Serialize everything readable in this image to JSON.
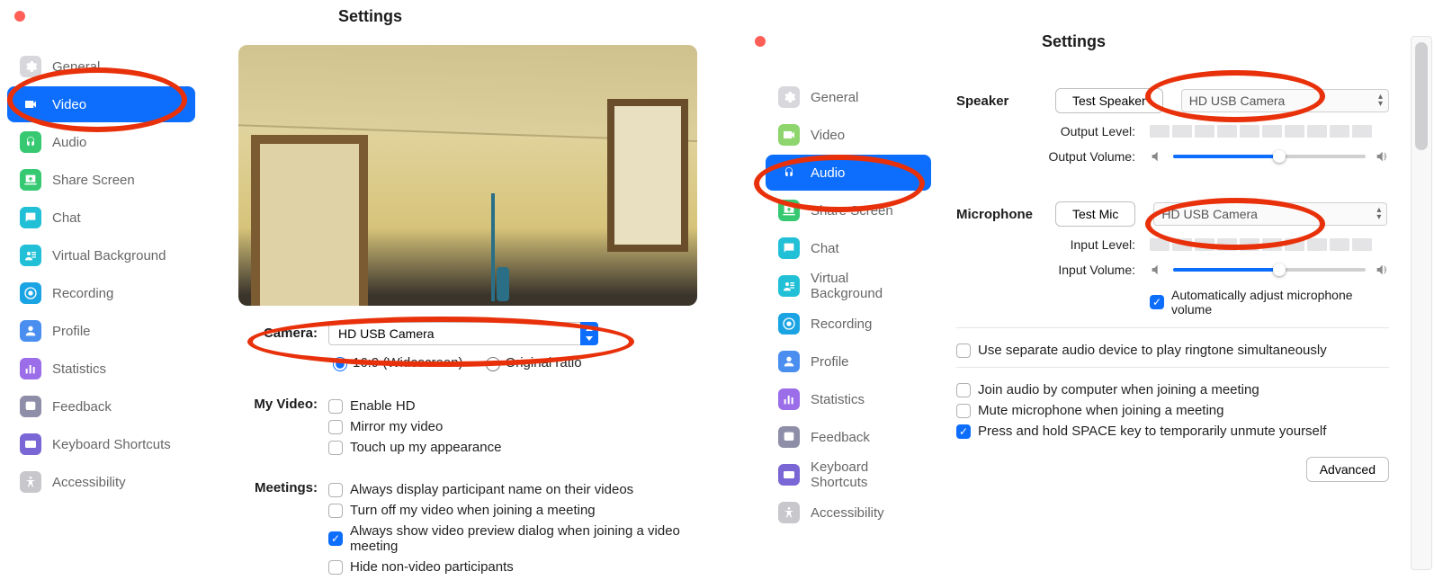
{
  "left": {
    "title": "Settings",
    "sidebar": [
      {
        "key": "general",
        "label": "General",
        "color": "#d7d7dc"
      },
      {
        "key": "video",
        "label": "Video",
        "color": "#0d6efd"
      },
      {
        "key": "audio",
        "label": "Audio",
        "color": "#36c971"
      },
      {
        "key": "share",
        "label": "Share Screen",
        "color": "#36c971"
      },
      {
        "key": "chat",
        "label": "Chat",
        "color": "#22c0d6"
      },
      {
        "key": "vbg",
        "label": "Virtual Background",
        "color": "#22c0d6"
      },
      {
        "key": "rec",
        "label": "Recording",
        "color": "#1aa4e4"
      },
      {
        "key": "profile",
        "label": "Profile",
        "color": "#4a8ff0"
      },
      {
        "key": "stats",
        "label": "Statistics",
        "color": "#9b6de8"
      },
      {
        "key": "feedback",
        "label": "Feedback",
        "color": "#8e8ea8"
      },
      {
        "key": "kbd",
        "label": "Keyboard Shortcuts",
        "color": "#7a66d5"
      },
      {
        "key": "a11y",
        "label": "Accessibility",
        "color": "#c7c7cc"
      }
    ],
    "selected": "video",
    "camera_label": "Camera:",
    "camera_value": "HD USB Camera",
    "myvideo_label": "My Video:",
    "meetings_label": "Meetings:",
    "ratio": {
      "wide": "16:9 (Widescreen)",
      "orig": "Original ratio",
      "value": "wide"
    },
    "myvideo": [
      {
        "k": "hd",
        "label": "Enable HD",
        "checked": false
      },
      {
        "k": "mirror",
        "label": "Mirror my video",
        "checked": false
      },
      {
        "k": "touchup",
        "label": "Touch up my appearance",
        "checked": false
      }
    ],
    "meetings": [
      {
        "k": "names",
        "label": "Always display participant name on their videos",
        "checked": false
      },
      {
        "k": "turnoff",
        "label": "Turn off my video when joining a meeting",
        "checked": false
      },
      {
        "k": "preview",
        "label": "Always show video preview dialog when joining a video meeting",
        "checked": true
      },
      {
        "k": "hidenv",
        "label": "Hide non-video participants",
        "checked": false
      }
    ]
  },
  "right": {
    "title": "Settings",
    "sidebar": [
      {
        "key": "general",
        "label": "General",
        "color": "#d7d7dc"
      },
      {
        "key": "video",
        "label": "Video",
        "color": "#8ed56e"
      },
      {
        "key": "audio",
        "label": "Audio",
        "color": "#0d6efd"
      },
      {
        "key": "share",
        "label": "Share Screen",
        "color": "#36c971"
      },
      {
        "key": "chat",
        "label": "Chat",
        "color": "#22c0d6"
      },
      {
        "key": "vbg",
        "label": "Virtual Background",
        "color": "#22c0d6"
      },
      {
        "key": "rec",
        "label": "Recording",
        "color": "#1aa4e4"
      },
      {
        "key": "profile",
        "label": "Profile",
        "color": "#4a8ff0"
      },
      {
        "key": "stats",
        "label": "Statistics",
        "color": "#9b6de8"
      },
      {
        "key": "feedback",
        "label": "Feedback",
        "color": "#8e8ea8"
      },
      {
        "key": "kbd",
        "label": "Keyboard Shortcuts",
        "color": "#7a66d5"
      },
      {
        "key": "a11y",
        "label": "Accessibility",
        "color": "#c7c7cc"
      }
    ],
    "selected": "audio",
    "speaker": {
      "label": "Speaker",
      "test": "Test Speaker",
      "device": "HD USB Camera",
      "out_level_label": "Output Level:",
      "out_vol_label": "Output Volume:",
      "volume": 55
    },
    "mic": {
      "label": "Microphone",
      "test": "Test Mic",
      "device": "HD USB Camera",
      "in_level_label": "Input Level:",
      "in_vol_label": "Input Volume:",
      "volume": 55,
      "auto_label": "Automatically adjust microphone volume",
      "auto": true
    },
    "ringtone": {
      "label": "Use separate audio device to play ringtone simultaneously",
      "checked": false
    },
    "opts": [
      {
        "k": "joinaudio",
        "label": "Join audio by computer when joining a meeting",
        "checked": false
      },
      {
        "k": "mutejoin",
        "label": "Mute microphone when joining a meeting",
        "checked": false
      },
      {
        "k": "space",
        "label": "Press and hold SPACE key to temporarily unmute yourself",
        "checked": true
      }
    ],
    "advanced": "Advanced"
  }
}
